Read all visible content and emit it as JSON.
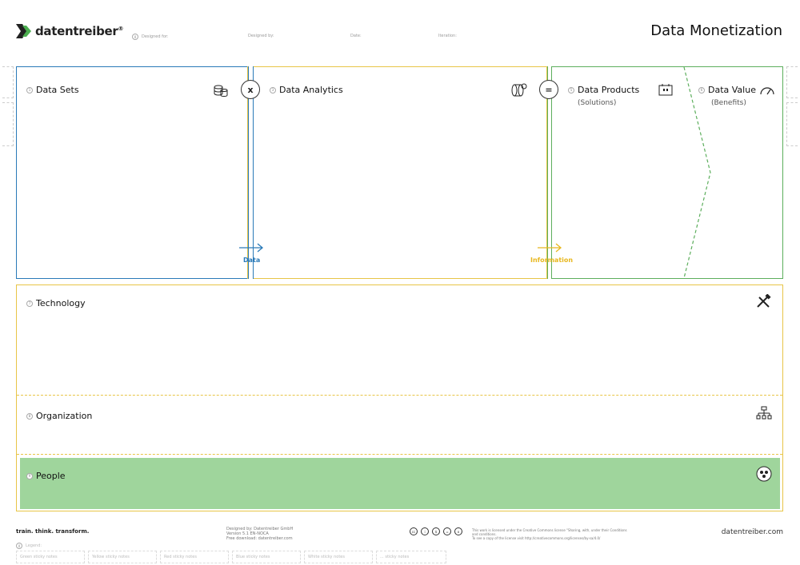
{
  "brand": {
    "name": "datentreiber",
    "reg": "®"
  },
  "header": {
    "designed_for": "Designed for:",
    "designed_by": "Designed by:",
    "date": "Date:",
    "iteration": "Iteration:",
    "title": "Data Monetization"
  },
  "canvas": {
    "data_sets": {
      "num": "1",
      "label": "Data Sets"
    },
    "data_analytics": {
      "num": "3",
      "label": "Data Analytics"
    },
    "data_products": {
      "num": "5",
      "label": "Data Products",
      "sub": "(Solutions)"
    },
    "data_value": {
      "num": "6",
      "label": "Data Value",
      "sub": "(Benefits)"
    },
    "op_multiply": "x",
    "op_equals": "=",
    "flow_data": "Data",
    "flow_information": "Information",
    "technology": {
      "num": "7",
      "label": "Technology"
    },
    "organization": {
      "num": "8",
      "label": "Organization"
    },
    "people": {
      "num": "9",
      "label": "People"
    }
  },
  "footer": {
    "tagline": "train. think. transform.",
    "credits_1": "Designed by: Datentreiber GmbH",
    "credits_2": "Version 5.1 EN-NOCA",
    "credits_3": "Free download: datentreiber.com",
    "license_1": "This work is licensed under the Creative Commons license \"Sharing, with, under their Conditions and conditions.",
    "license_2": "To see a copy of the license visit http://creativecommons.org/licenses/by-sa/4.0/",
    "site": "datentreiber.com",
    "legend_num": "0",
    "legend": "Legend:",
    "stickies": [
      "Green sticky notes",
      "Yellow sticky notes",
      "Red sticky notes",
      "Blue sticky notes",
      "White sticky notes",
      "... sticky notes"
    ]
  },
  "colors": {
    "blue": "#2a7ab8",
    "yellow": "#e8c547",
    "green": "#5cae5c",
    "people": "#9fd59c"
  },
  "icons": [
    "logo-arrow-icon",
    "database-coins-icon",
    "analytics-cylinder-icon",
    "product-board-icon",
    "speedometer-icon",
    "tools-icon",
    "org-chart-icon",
    "people-group-icon",
    "cc-license-icons"
  ]
}
